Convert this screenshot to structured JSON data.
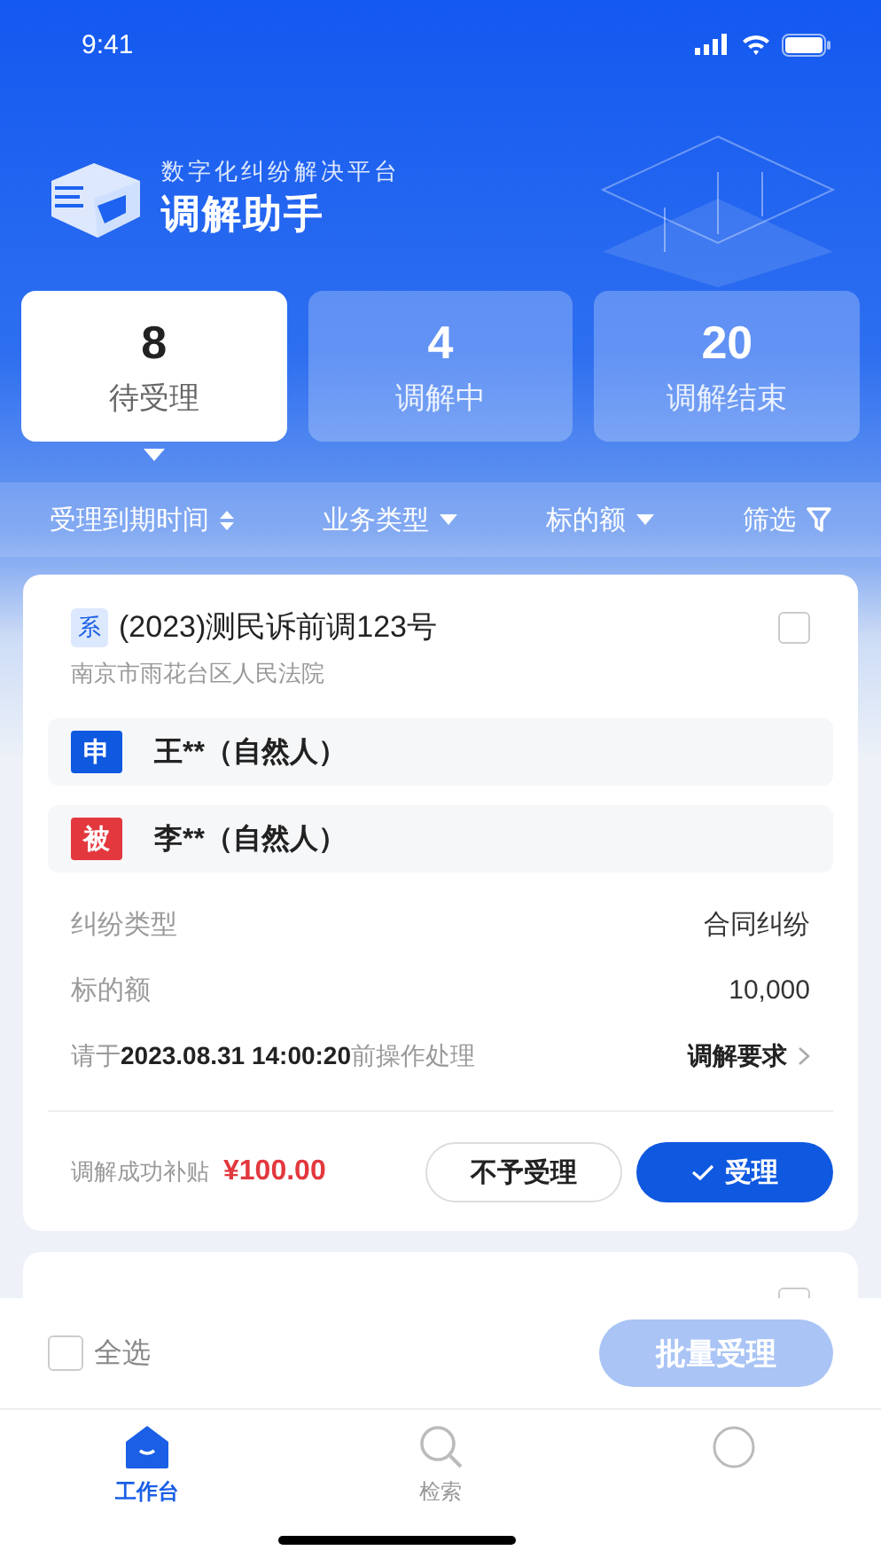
{
  "status_bar": {
    "time": "9:41"
  },
  "header": {
    "subtitle": "数字化纠纷解决平台",
    "title": "调解助手"
  },
  "stats": [
    {
      "count": "8",
      "label": "待受理",
      "selected": true
    },
    {
      "count": "4",
      "label": "调解中",
      "selected": false
    },
    {
      "count": "20",
      "label": "调解结束",
      "selected": false
    }
  ],
  "filters": [
    {
      "label": "受理到期时间",
      "kind": "sort"
    },
    {
      "label": "业务类型",
      "kind": "dropdown"
    },
    {
      "label": "标的额",
      "kind": "dropdown"
    },
    {
      "label": "筛选",
      "kind": "filter"
    }
  ],
  "cases": [
    {
      "tag": "系",
      "title": "(2023)测民诉前调123号",
      "checked": false,
      "court": "南京市雨花台区人民法院",
      "parties": [
        {
          "role": "申",
          "name": "王**（自然人）",
          "kind": "applicant"
        },
        {
          "role": "被",
          "name": "李**（自然人）",
          "kind": "respondent"
        }
      ],
      "fields": [
        {
          "label": "纠纷类型",
          "value": "合同纠纷"
        },
        {
          "label": "标的额",
          "value": "10,000"
        }
      ],
      "deadline": "请于**2023.08.31 14:00:20**前操作处理",
      "link": "调解要求",
      "subsidy_label": "调解成功补贴",
      "subsidy": "¥100.00",
      "buttons": [
        {
          "label": "不予受理",
          "kind": "outline"
        },
        {
          "label": "受理",
          "kind": "primary"
        }
      ]
    },
    {
      "checked": false
    }
  ],
  "batch": {
    "select_all": {
      "label": "全选",
      "checked": false
    },
    "button": {
      "label": "批量受理",
      "disabled": true
    }
  },
  "tabbar": [
    {
      "label": "工作台",
      "selected": true
    },
    {
      "label": "检索",
      "selected": false
    },
    {
      "selected": false
    }
  ]
}
